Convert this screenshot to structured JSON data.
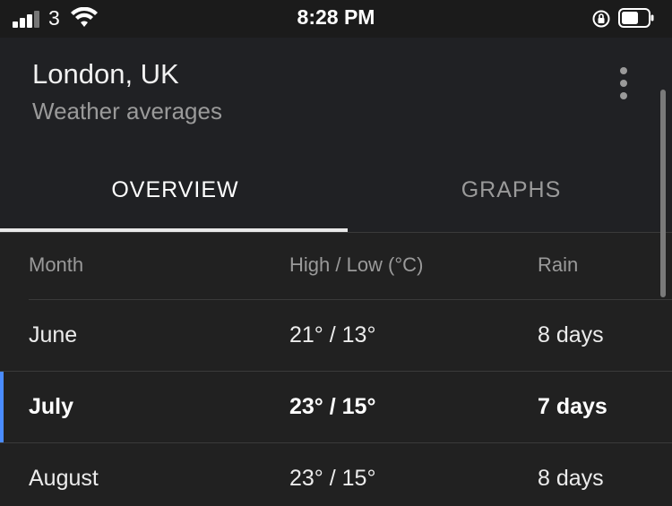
{
  "status_bar": {
    "carrier": "3",
    "time": "8:28 PM",
    "icons": [
      "signal-icon",
      "wifi-icon",
      "rotation-lock-icon",
      "battery-icon"
    ]
  },
  "header": {
    "title": "London, UK",
    "subtitle": "Weather averages",
    "menu_icon": "more-vertical-icon"
  },
  "tabs": [
    {
      "label": "OVERVIEW",
      "active": true
    },
    {
      "label": "GRAPHS",
      "active": false
    }
  ],
  "table": {
    "columns": [
      "Month",
      "High / Low (°C)",
      "Rain"
    ],
    "rows": [
      {
        "month": "June",
        "temp": "21° / 13°",
        "rain": "8 days",
        "selected": false
      },
      {
        "month": "July",
        "temp": "23° / 15°",
        "rain": "7 days",
        "selected": true
      },
      {
        "month": "August",
        "temp": "23° / 15°",
        "rain": "8 days",
        "selected": false
      }
    ]
  },
  "colors": {
    "accent": "#4a8cff",
    "background": "#202124",
    "muted_text": "#9a9a9a"
  }
}
